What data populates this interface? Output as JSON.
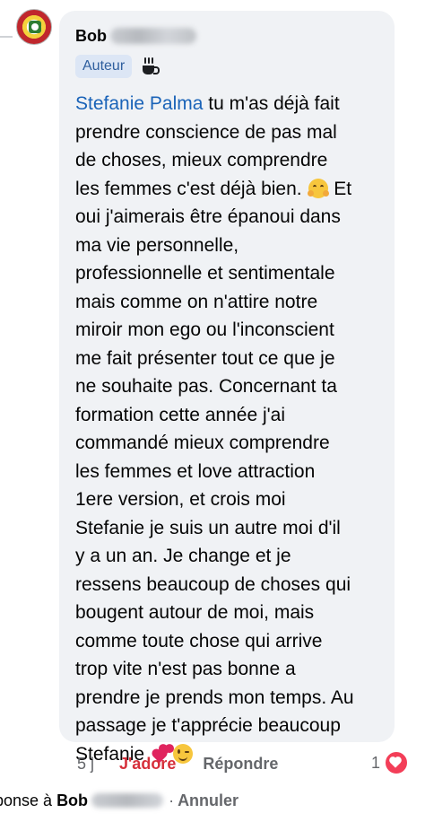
{
  "comment": {
    "author_first_name": "Bob",
    "author_badge": "Auteur",
    "badge_icon": "coffee-icon",
    "mention": "Stefanie Palma",
    "text_part1": " tu m'as déjà fait\nprendre conscience de pas mal\nde choses, mieux comprendre\nles femmes c'est déjà bien. ",
    "text_part2": " Et\noui j'aimerais être épanoui dans\nma vie personnelle,\nprofessionnelle et sentimentale\nmais comme on n'attire notre\nmiroir mon ego ou l'inconscient\nme fait présenter tout ce que je\nne souhaite pas. Concernant ta\nformation cette année j'ai\ncommandé mieux comprendre\nles femmes et love attraction\n1ere version, et crois moi\nStefanie je suis un autre moi d'il\ny a un an. Je change et je\nressens beaucoup de choses qui\nbougent autour de moi, mais\ncomme toute chose qui arrive\ntrop vite n'est pas bonne a\nprendre je prends mon temps. Au\npassage je t'apprécie beaucoup\nStefanie ",
    "emojis": [
      "hugging-face-emoji",
      "two-hearts-emoji",
      "winking-face-emoji"
    ]
  },
  "actions": {
    "time": "5 j",
    "like_label": "J'adore",
    "reply_label": "Répondre",
    "reaction_count": "1",
    "reaction_icon": "love-reaction-icon",
    "like_color": "#d6303b"
  },
  "reply_bar": {
    "prefix": "ponse à",
    "name": "Bob",
    "separator": "·",
    "cancel_label": "Annuler"
  },
  "colors": {
    "bubble": "#f0f2f5",
    "mention": "#1a63b8",
    "badge_bg": "#dce6f5",
    "badge_text": "#2f5f9e"
  }
}
